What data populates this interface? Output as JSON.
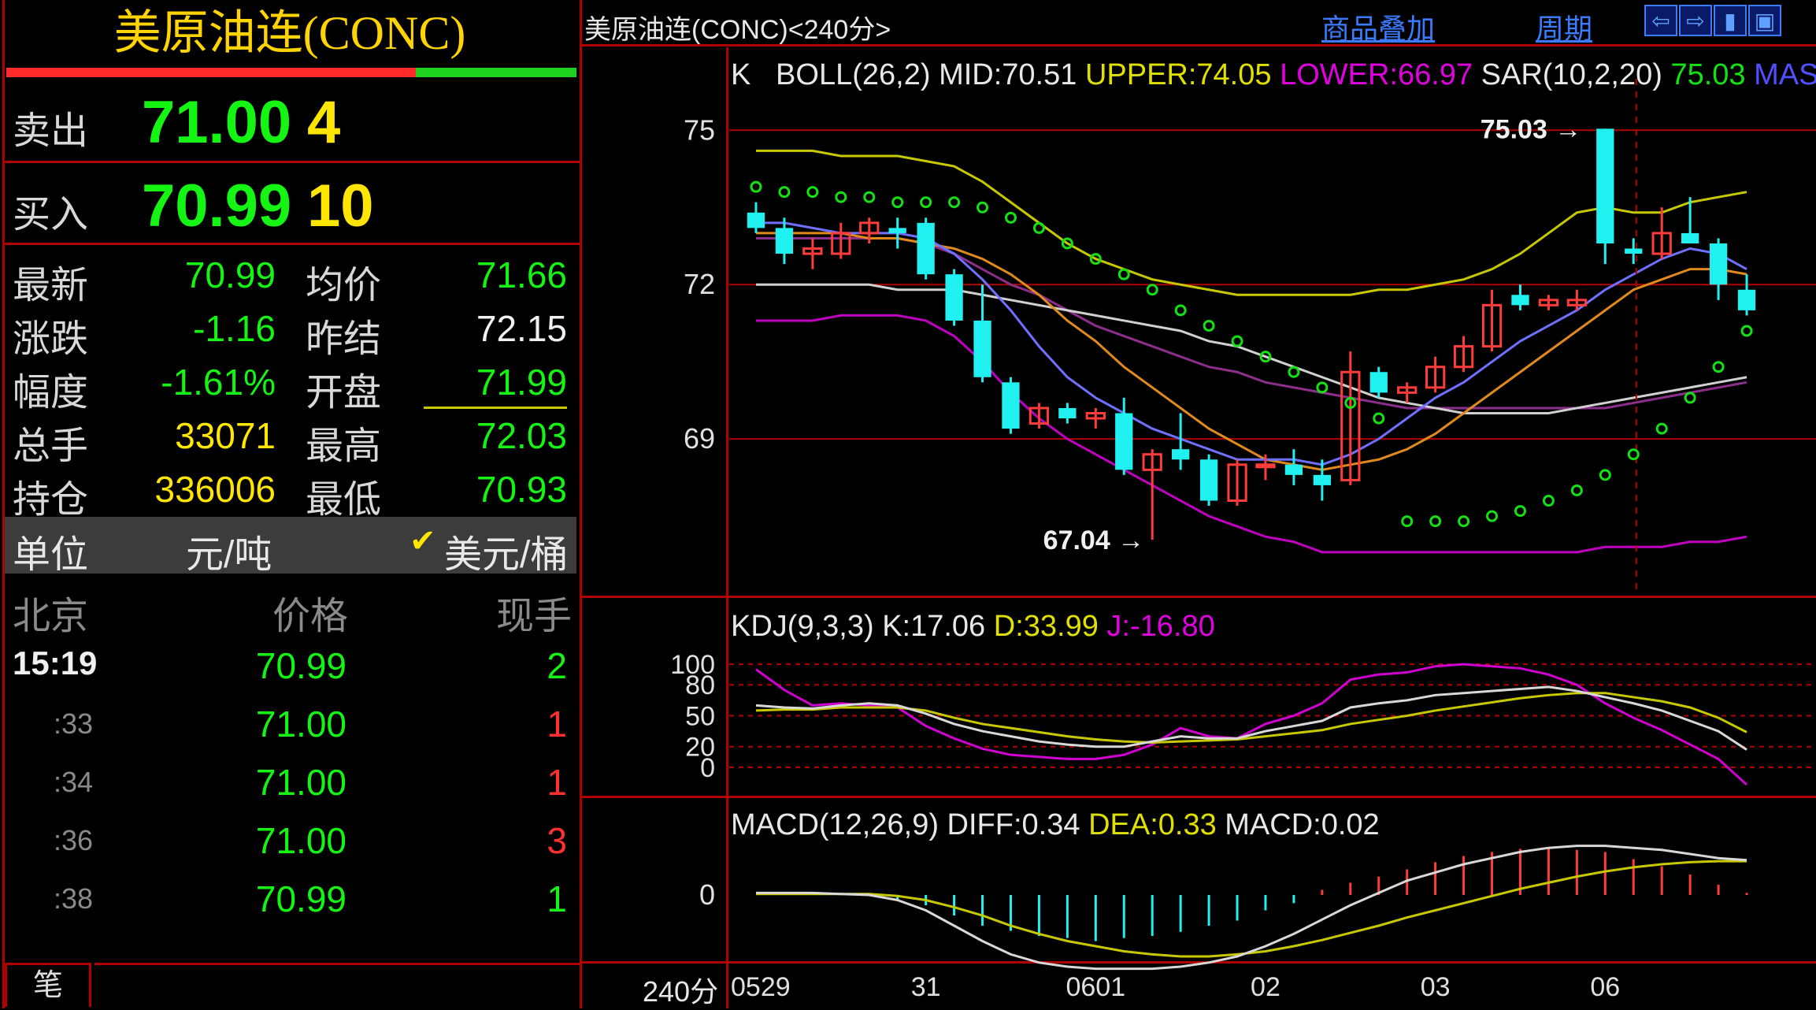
{
  "quote": {
    "title": "美原油连(CONC)",
    "sell_label": "卖出",
    "sell_price": "71.00",
    "sell_qty": "4",
    "buy_label": "买入",
    "buy_price": "70.99",
    "buy_qty": "10",
    "stats": [
      {
        "label": "最新",
        "value": "70.99",
        "label2": "均价",
        "value2": "71.66"
      },
      {
        "label": "涨跌",
        "value": "-1.16",
        "label2": "昨结",
        "value2": "72.15"
      },
      {
        "label": "幅度",
        "value": "-1.61%",
        "label2": "开盘",
        "value2": "71.99"
      },
      {
        "label": "总手",
        "value": "33071",
        "label2": "最高",
        "value2": "72.03"
      },
      {
        "label": "持仓",
        "value": "336006",
        "label2": "最低",
        "value2": "70.93"
      }
    ],
    "unit_label": "单位",
    "unit_value": "元/吨",
    "unit_alt": "美元/桶",
    "unit_check": "✔",
    "trades_header": {
      "time": "北京",
      "price": "价格",
      "qty": "现手"
    },
    "trades": [
      {
        "time": "15:19",
        "price": "70.99",
        "qty": "2"
      },
      {
        "time": ":33",
        "price": "71.00",
        "qty": "1"
      },
      {
        "time": ":34",
        "price": "71.00",
        "qty": "1"
      },
      {
        "time": ":36",
        "price": "71.00",
        "qty": "3"
      },
      {
        "time": ":38",
        "price": "70.99",
        "qty": "1"
      }
    ],
    "bottom_tab": "笔"
  },
  "chart_header": {
    "title": "美原油连(CONC)<240分>",
    "link1": "商品叠加",
    "link2": "周期",
    "buttons": [
      "⇦",
      "⇨",
      "▮",
      "▣"
    ]
  },
  "main_indicator": {
    "k": "K",
    "boll": "BOLL(26,2)",
    "mid": "MID:70.51",
    "upper": "UPPER:74.05",
    "lower": "LOWER:66.97",
    "sar": "SAR(10,2,20)",
    "sar_val": "75.03",
    "mas": "MAS"
  },
  "kdj_indicator": {
    "name": "KDJ(9,3,3)",
    "k": "K:17.06",
    "d": "D:33.99",
    "j": "J:-16.80"
  },
  "macd_indicator": {
    "name": "MACD(12,26,9)",
    "diff": "DIFF:0.34",
    "dea": "DEA:0.33",
    "macd": "MACD:0.02"
  },
  "annotations": {
    "high": "75.03",
    "low": "67.04"
  },
  "period_label": "240分",
  "colors": {
    "up": "#ff3c3c",
    "down": "#20f0f0",
    "grid": "#b00000",
    "upper": "#c8c800",
    "lower": "#c000c0",
    "sar": "#14e014"
  },
  "chart_data": [
    {
      "type": "candlestick",
      "x": [
        "0529",
        "0529",
        "0529",
        "0529",
        "0529",
        "0529",
        "31",
        "31",
        "31",
        "31",
        "31",
        "31",
        "0601",
        "0601",
        "0601",
        "0601",
        "0601",
        "0601",
        "02",
        "02",
        "02",
        "02",
        "02",
        "02",
        "03",
        "03",
        "03",
        "03",
        "03",
        "03",
        "06",
        "06",
        "06",
        "06",
        "06",
        "06"
      ],
      "x_ticks": [
        "0529",
        "31",
        "0601",
        "02",
        "03",
        "06"
      ],
      "y_ticks": [
        75,
        72,
        69
      ],
      "ylim": [
        66.2,
        76.0
      ],
      "candles": [
        {
          "o": 73.4,
          "h": 73.6,
          "l": 73.0,
          "c": 73.1
        },
        {
          "o": 73.1,
          "h": 73.3,
          "l": 72.4,
          "c": 72.6
        },
        {
          "o": 72.6,
          "h": 72.9,
          "l": 72.3,
          "c": 72.7
        },
        {
          "o": 72.6,
          "h": 73.2,
          "l": 72.5,
          "c": 73.0
        },
        {
          "o": 73.0,
          "h": 73.3,
          "l": 72.8,
          "c": 73.2
        },
        {
          "o": 73.1,
          "h": 73.3,
          "l": 72.7,
          "c": 73.0
        },
        {
          "o": 73.2,
          "h": 73.3,
          "l": 72.1,
          "c": 72.2
        },
        {
          "o": 72.2,
          "h": 72.3,
          "l": 71.2,
          "c": 71.3
        },
        {
          "o": 71.3,
          "h": 72.0,
          "l": 70.1,
          "c": 70.2
        },
        {
          "o": 70.1,
          "h": 70.2,
          "l": 69.1,
          "c": 69.2
        },
        {
          "o": 69.3,
          "h": 69.7,
          "l": 69.2,
          "c": 69.6
        },
        {
          "o": 69.6,
          "h": 69.7,
          "l": 69.3,
          "c": 69.4
        },
        {
          "o": 69.4,
          "h": 69.6,
          "l": 69.2,
          "c": 69.5
        },
        {
          "o": 69.5,
          "h": 69.8,
          "l": 68.3,
          "c": 68.4
        },
        {
          "o": 68.4,
          "h": 68.8,
          "l": 67.04,
          "c": 68.7
        },
        {
          "o": 68.8,
          "h": 69.5,
          "l": 68.4,
          "c": 68.6
        },
        {
          "o": 68.6,
          "h": 68.7,
          "l": 67.7,
          "c": 67.8
        },
        {
          "o": 67.8,
          "h": 68.6,
          "l": 67.7,
          "c": 68.5
        },
        {
          "o": 68.5,
          "h": 68.7,
          "l": 68.2,
          "c": 68.5
        },
        {
          "o": 68.5,
          "h": 68.8,
          "l": 68.1,
          "c": 68.3
        },
        {
          "o": 68.3,
          "h": 68.6,
          "l": 67.8,
          "c": 68.1
        },
        {
          "o": 68.2,
          "h": 70.7,
          "l": 68.1,
          "c": 70.3
        },
        {
          "o": 70.3,
          "h": 70.4,
          "l": 69.8,
          "c": 69.9
        },
        {
          "o": 69.9,
          "h": 70.1,
          "l": 69.7,
          "c": 70.0
        },
        {
          "o": 70.0,
          "h": 70.6,
          "l": 69.9,
          "c": 70.4
        },
        {
          "o": 70.4,
          "h": 71.0,
          "l": 70.3,
          "c": 70.8
        },
        {
          "o": 70.8,
          "h": 71.9,
          "l": 70.7,
          "c": 71.6
        },
        {
          "o": 71.8,
          "h": 72.0,
          "l": 71.5,
          "c": 71.6
        },
        {
          "o": 71.6,
          "h": 71.8,
          "l": 71.5,
          "c": 71.7
        },
        {
          "o": 71.6,
          "h": 71.9,
          "l": 71.5,
          "c": 71.7
        },
        {
          "o": 75.03,
          "h": 75.03,
          "l": 72.4,
          "c": 72.8
        },
        {
          "o": 72.7,
          "h": 72.9,
          "l": 72.4,
          "c": 72.6
        },
        {
          "o": 72.6,
          "h": 73.5,
          "l": 72.5,
          "c": 73.0
        },
        {
          "o": 73.0,
          "h": 73.7,
          "l": 72.8,
          "c": 72.8
        },
        {
          "o": 72.8,
          "h": 72.9,
          "l": 71.7,
          "c": 72.0
        },
        {
          "o": 71.9,
          "h": 72.2,
          "l": 71.4,
          "c": 71.5
        }
      ],
      "upper": [
        74.6,
        74.6,
        74.6,
        74.5,
        74.5,
        74.5,
        74.4,
        74.3,
        74.0,
        73.6,
        73.2,
        72.8,
        72.5,
        72.3,
        72.1,
        72.0,
        71.9,
        71.8,
        71.8,
        71.8,
        71.8,
        71.8,
        71.9,
        71.9,
        72.0,
        72.1,
        72.3,
        72.6,
        73.0,
        73.4,
        73.5,
        73.4,
        73.4,
        73.6,
        73.7,
        73.8
      ],
      "lower": [
        71.3,
        71.3,
        71.3,
        71.4,
        71.4,
        71.4,
        71.3,
        71.0,
        70.5,
        69.9,
        69.4,
        69.0,
        68.7,
        68.4,
        68.1,
        67.8,
        67.5,
        67.3,
        67.1,
        67.0,
        66.8,
        66.8,
        66.8,
        66.8,
        66.8,
        66.8,
        66.8,
        66.8,
        66.8,
        66.8,
        66.9,
        66.9,
        66.9,
        67.0,
        67.0,
        67.1
      ],
      "mid": [
        72.9,
        72.9,
        72.9,
        72.9,
        72.9,
        72.9,
        72.8,
        72.6,
        72.3,
        72.0,
        71.8,
        71.5,
        71.2,
        71.0,
        70.8,
        70.6,
        70.4,
        70.3,
        70.1,
        70.0,
        69.9,
        69.8,
        69.7,
        69.6,
        69.6,
        69.6,
        69.6,
        69.6,
        69.6,
        69.6,
        69.6,
        69.7,
        69.8,
        69.9,
        70.0,
        70.1
      ],
      "sar": [
        73.9,
        73.8,
        73.8,
        73.7,
        73.7,
        73.6,
        73.6,
        73.6,
        73.5,
        73.3,
        73.1,
        72.8,
        72.5,
        72.2,
        71.9,
        71.5,
        71.2,
        70.9,
        70.6,
        70.3,
        70.0,
        69.7,
        69.4,
        67.4,
        67.4,
        67.4,
        67.5,
        67.6,
        67.8,
        68.0,
        68.3,
        68.7,
        69.2,
        69.8,
        70.4,
        71.1
      ],
      "ma1": [
        73.2,
        73.2,
        73.1,
        73.0,
        73.0,
        73.0,
        72.9,
        72.6,
        72.1,
        71.5,
        70.8,
        70.2,
        69.8,
        69.5,
        69.2,
        69.0,
        68.8,
        68.6,
        68.6,
        68.6,
        68.5,
        68.7,
        69.0,
        69.4,
        69.8,
        70.1,
        70.5,
        70.9,
        71.2,
        71.5,
        71.9,
        72.2,
        72.5,
        72.7,
        72.6,
        72.3
      ],
      "ma2": [
        73.0,
        73.0,
        73.0,
        73.0,
        72.9,
        72.9,
        72.8,
        72.7,
        72.5,
        72.2,
        71.8,
        71.3,
        70.9,
        70.4,
        70.0,
        69.6,
        69.2,
        68.9,
        68.6,
        68.5,
        68.4,
        68.5,
        68.6,
        68.8,
        69.1,
        69.5,
        69.9,
        70.3,
        70.7,
        71.1,
        71.5,
        71.9,
        72.1,
        72.3,
        72.3,
        72.2
      ],
      "ma3": [
        72.0,
        72.0,
        72.0,
        72.0,
        72.0,
        71.9,
        71.9,
        71.9,
        71.8,
        71.7,
        71.6,
        71.5,
        71.4,
        71.3,
        71.2,
        71.1,
        70.9,
        70.8,
        70.6,
        70.4,
        70.2,
        70.0,
        69.8,
        69.7,
        69.6,
        69.5,
        69.5,
        69.5,
        69.5,
        69.6,
        69.7,
        69.8,
        69.9,
        70.0,
        70.1,
        70.2
      ]
    },
    {
      "type": "line",
      "title": "KDJ(9,3,3)",
      "y_ticks": [
        100,
        80,
        50,
        20,
        0
      ],
      "ylim": [
        -20,
        110
      ],
      "k": [
        60,
        58,
        57,
        60,
        62,
        60,
        52,
        42,
        35,
        30,
        25,
        22,
        20,
        20,
        25,
        30,
        28,
        28,
        35,
        40,
        45,
        58,
        62,
        65,
        70,
        72,
        74,
        76,
        78,
        74,
        68,
        62,
        55,
        45,
        35,
        17
      ],
      "d": [
        55,
        56,
        56,
        58,
        58,
        58,
        55,
        48,
        42,
        38,
        34,
        30,
        27,
        25,
        24,
        25,
        26,
        27,
        30,
        33,
        36,
        42,
        46,
        50,
        55,
        59,
        63,
        67,
        70,
        72,
        72,
        68,
        64,
        58,
        48,
        34
      ],
      "j": [
        95,
        75,
        60,
        62,
        60,
        58,
        40,
        28,
        18,
        12,
        10,
        8,
        8,
        12,
        22,
        38,
        30,
        28,
        42,
        50,
        62,
        85,
        90,
        92,
        98,
        100,
        98,
        96,
        90,
        80,
        62,
        48,
        36,
        22,
        8,
        -17
      ]
    },
    {
      "type": "bar",
      "title": "MACD(12,26,9)",
      "y_ticks": [
        0
      ],
      "macd": [
        0,
        0,
        0,
        0,
        0,
        -0.05,
        -0.1,
        -0.2,
        -0.3,
        -0.35,
        -0.4,
        -0.42,
        -0.45,
        -0.42,
        -0.4,
        -0.36,
        -0.3,
        -0.25,
        -0.15,
        -0.08,
        0.05,
        0.12,
        0.18,
        0.25,
        0.32,
        0.38,
        0.42,
        0.45,
        0.45,
        0.44,
        0.42,
        0.35,
        0.28,
        0.2,
        0.1,
        0.02
      ],
      "diff": [
        0.02,
        0.02,
        0.02,
        0.01,
        0,
        -0.05,
        -0.15,
        -0.3,
        -0.45,
        -0.58,
        -0.66,
        -0.7,
        -0.72,
        -0.72,
        -0.72,
        -0.7,
        -0.66,
        -0.6,
        -0.5,
        -0.38,
        -0.24,
        -0.1,
        0.02,
        0.14,
        0.22,
        0.3,
        0.36,
        0.42,
        0.46,
        0.48,
        0.48,
        0.46,
        0.44,
        0.4,
        0.36,
        0.34
      ],
      "dea": [
        0.01,
        0.01,
        0.01,
        0.01,
        0.01,
        -0.01,
        -0.05,
        -0.12,
        -0.2,
        -0.3,
        -0.38,
        -0.45,
        -0.5,
        -0.55,
        -0.58,
        -0.6,
        -0.6,
        -0.58,
        -0.55,
        -0.5,
        -0.44,
        -0.37,
        -0.3,
        -0.22,
        -0.15,
        -0.08,
        -0.01,
        0.06,
        0.12,
        0.18,
        0.23,
        0.27,
        0.3,
        0.32,
        0.33,
        0.33
      ]
    }
  ]
}
